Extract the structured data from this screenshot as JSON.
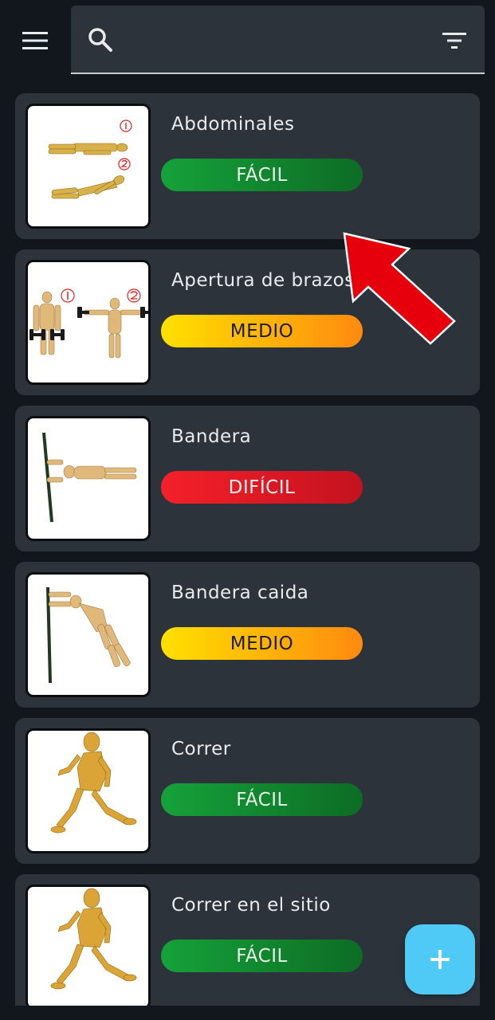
{
  "search": {
    "value": "",
    "placeholder": ""
  },
  "icons": {
    "menu": "hamburger-menu-icon",
    "search": "search-icon",
    "filter": "filter-icon",
    "add": "plus-icon"
  },
  "colors": {
    "background": "#12171d",
    "card": "#2d333b",
    "easy": "#15a23a",
    "medium": "#ffb000",
    "hard": "#e81a25",
    "fab": "#4fc9f5",
    "annotation_arrow": "#e5000b"
  },
  "exercises": [
    {
      "name": "Abdominales",
      "difficulty": "FÁCIL"
    },
    {
      "name": "Apertura de brazos",
      "difficulty": "MEDIO"
    },
    {
      "name": "Bandera",
      "difficulty": "DIFÍCIL"
    },
    {
      "name": "Bandera caida",
      "difficulty": "MEDIO"
    },
    {
      "name": "Correr",
      "difficulty": "FÁCIL"
    },
    {
      "name": "Correr en el sitio",
      "difficulty": "FÁCIL"
    }
  ]
}
